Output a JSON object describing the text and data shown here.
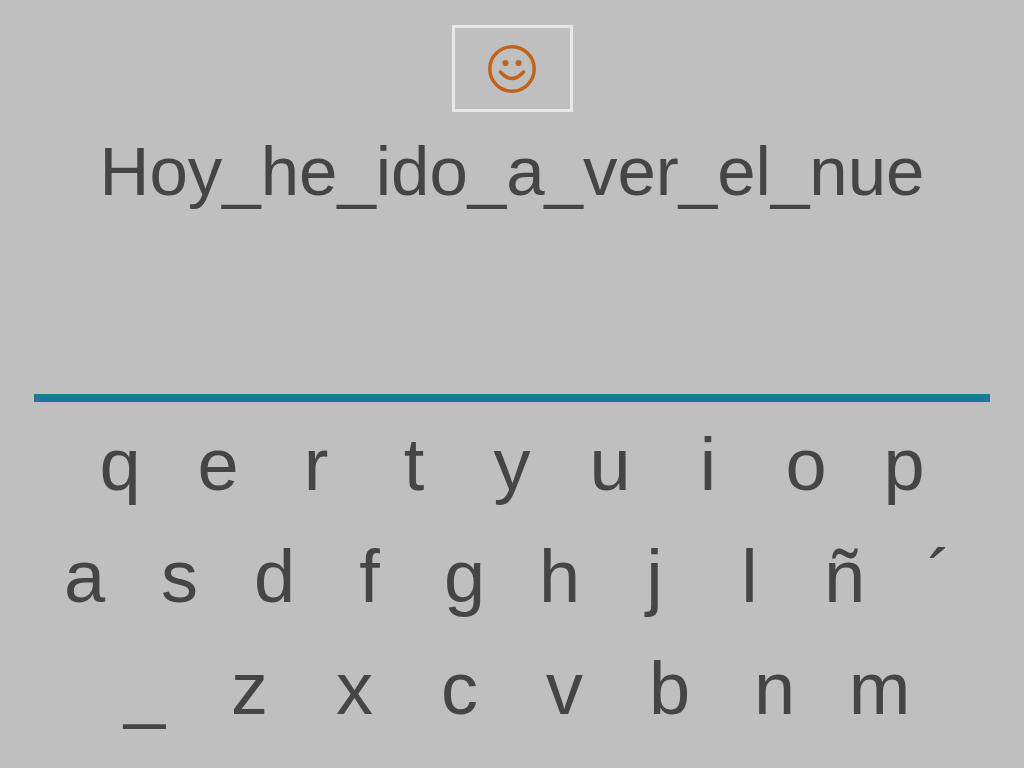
{
  "typed_text": "Hoy_he_ido_a_ver_el_nue",
  "keyboard": {
    "rows": [
      [
        "q",
        "e",
        "r",
        "t",
        "y",
        "u",
        "i",
        "o",
        "p"
      ],
      [
        "a",
        "s",
        "d",
        "f",
        "g",
        "h",
        "j",
        "l",
        "ñ",
        "´"
      ],
      [
        "_",
        "z",
        "x",
        "c",
        "v",
        "b",
        "n",
        "m"
      ]
    ]
  }
}
